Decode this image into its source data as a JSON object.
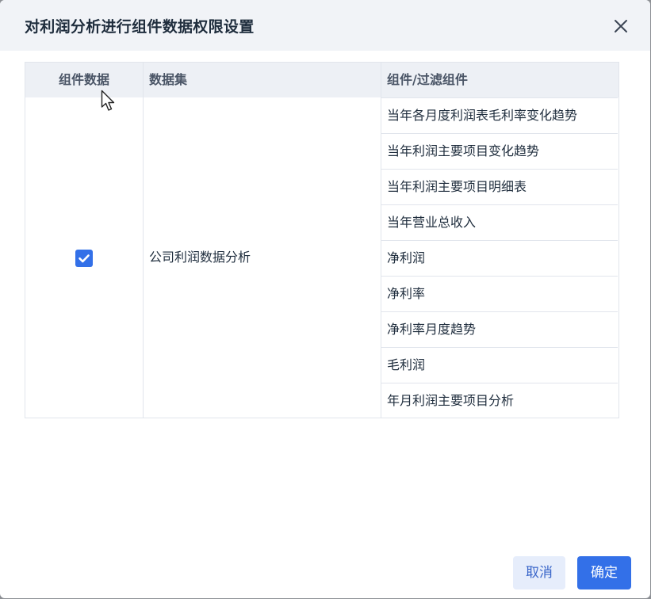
{
  "dialog": {
    "title": "对利润分析进行组件数据权限设置",
    "close_icon": "close-icon"
  },
  "table": {
    "headers": [
      "组件数据",
      "数据集",
      "组件/过滤组件"
    ],
    "rows": [
      {
        "checked": true,
        "dataset": "公司利润数据分析",
        "components": [
          "当年各月度利润表毛利率变化趋势",
          "当年利润主要项目变化趋势",
          "当年利润主要项目明细表",
          "当年营业总收入",
          "净利润",
          "净利率",
          "净利率月度趋势",
          "毛利润",
          "年月利润主要项目分析"
        ]
      }
    ]
  },
  "footer": {
    "cancel_label": "取消",
    "ok_label": "确定"
  },
  "colors": {
    "primary": "#3370e8",
    "header_bg": "#f1f3f7",
    "table_header_bg": "#edf0f5"
  }
}
